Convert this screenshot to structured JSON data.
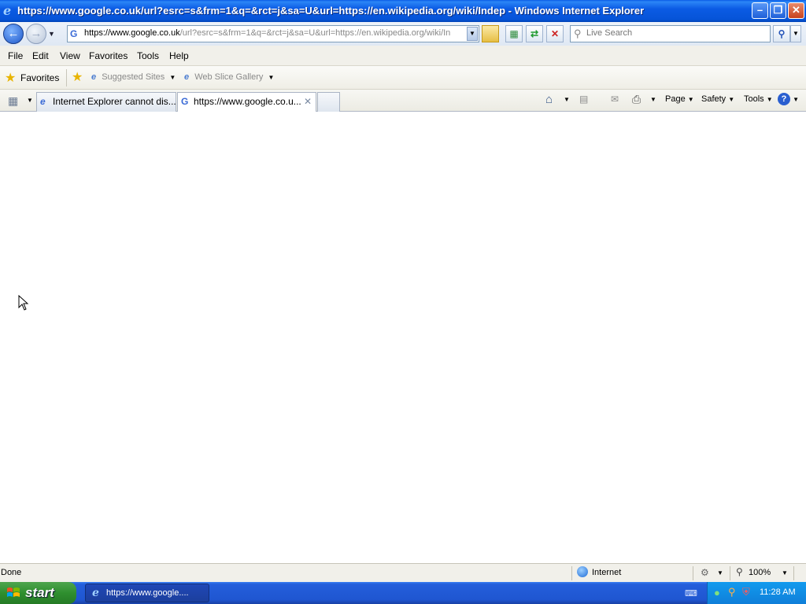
{
  "window": {
    "title": "https://www.google.co.uk/url?esrc=s&frm=1&q=&rct=j&sa=U&url=https://en.wikipedia.org/wiki/Indep - Windows Internet Explorer"
  },
  "address_bar": {
    "protocol": "https://",
    "host": "www.google.co.uk",
    "path": "/url?esrc=s&frm=1&q=&rct=j&sa=U&url=https://en.wikipedia.org/wiki/In"
  },
  "search": {
    "placeholder": "Live Search"
  },
  "menu": {
    "items": [
      "File",
      "Edit",
      "View",
      "Favorites",
      "Tools",
      "Help"
    ]
  },
  "favorites_bar": {
    "favorites_label": "Favorites",
    "suggested_sites": "Suggested Sites",
    "web_slice_gallery": "Web Slice Gallery"
  },
  "tabs": [
    {
      "label": "Internet Explorer cannot dis...",
      "active": false
    },
    {
      "label": "https://www.google.co.u...",
      "active": true
    }
  ],
  "command_bar": {
    "page": "Page",
    "safety": "Safety",
    "tools": "Tools"
  },
  "status_bar": {
    "status": "Done",
    "zone": "Internet",
    "zoom": "100%"
  },
  "taskbar": {
    "start_label": "start",
    "task_label": "https://www.google....",
    "clock": "11:28 AM"
  },
  "colors": {
    "title_bar": "#0a5ce6",
    "taskbar": "#245edb",
    "start_button": "#2f8f2f",
    "tray": "#0f7fd9"
  }
}
